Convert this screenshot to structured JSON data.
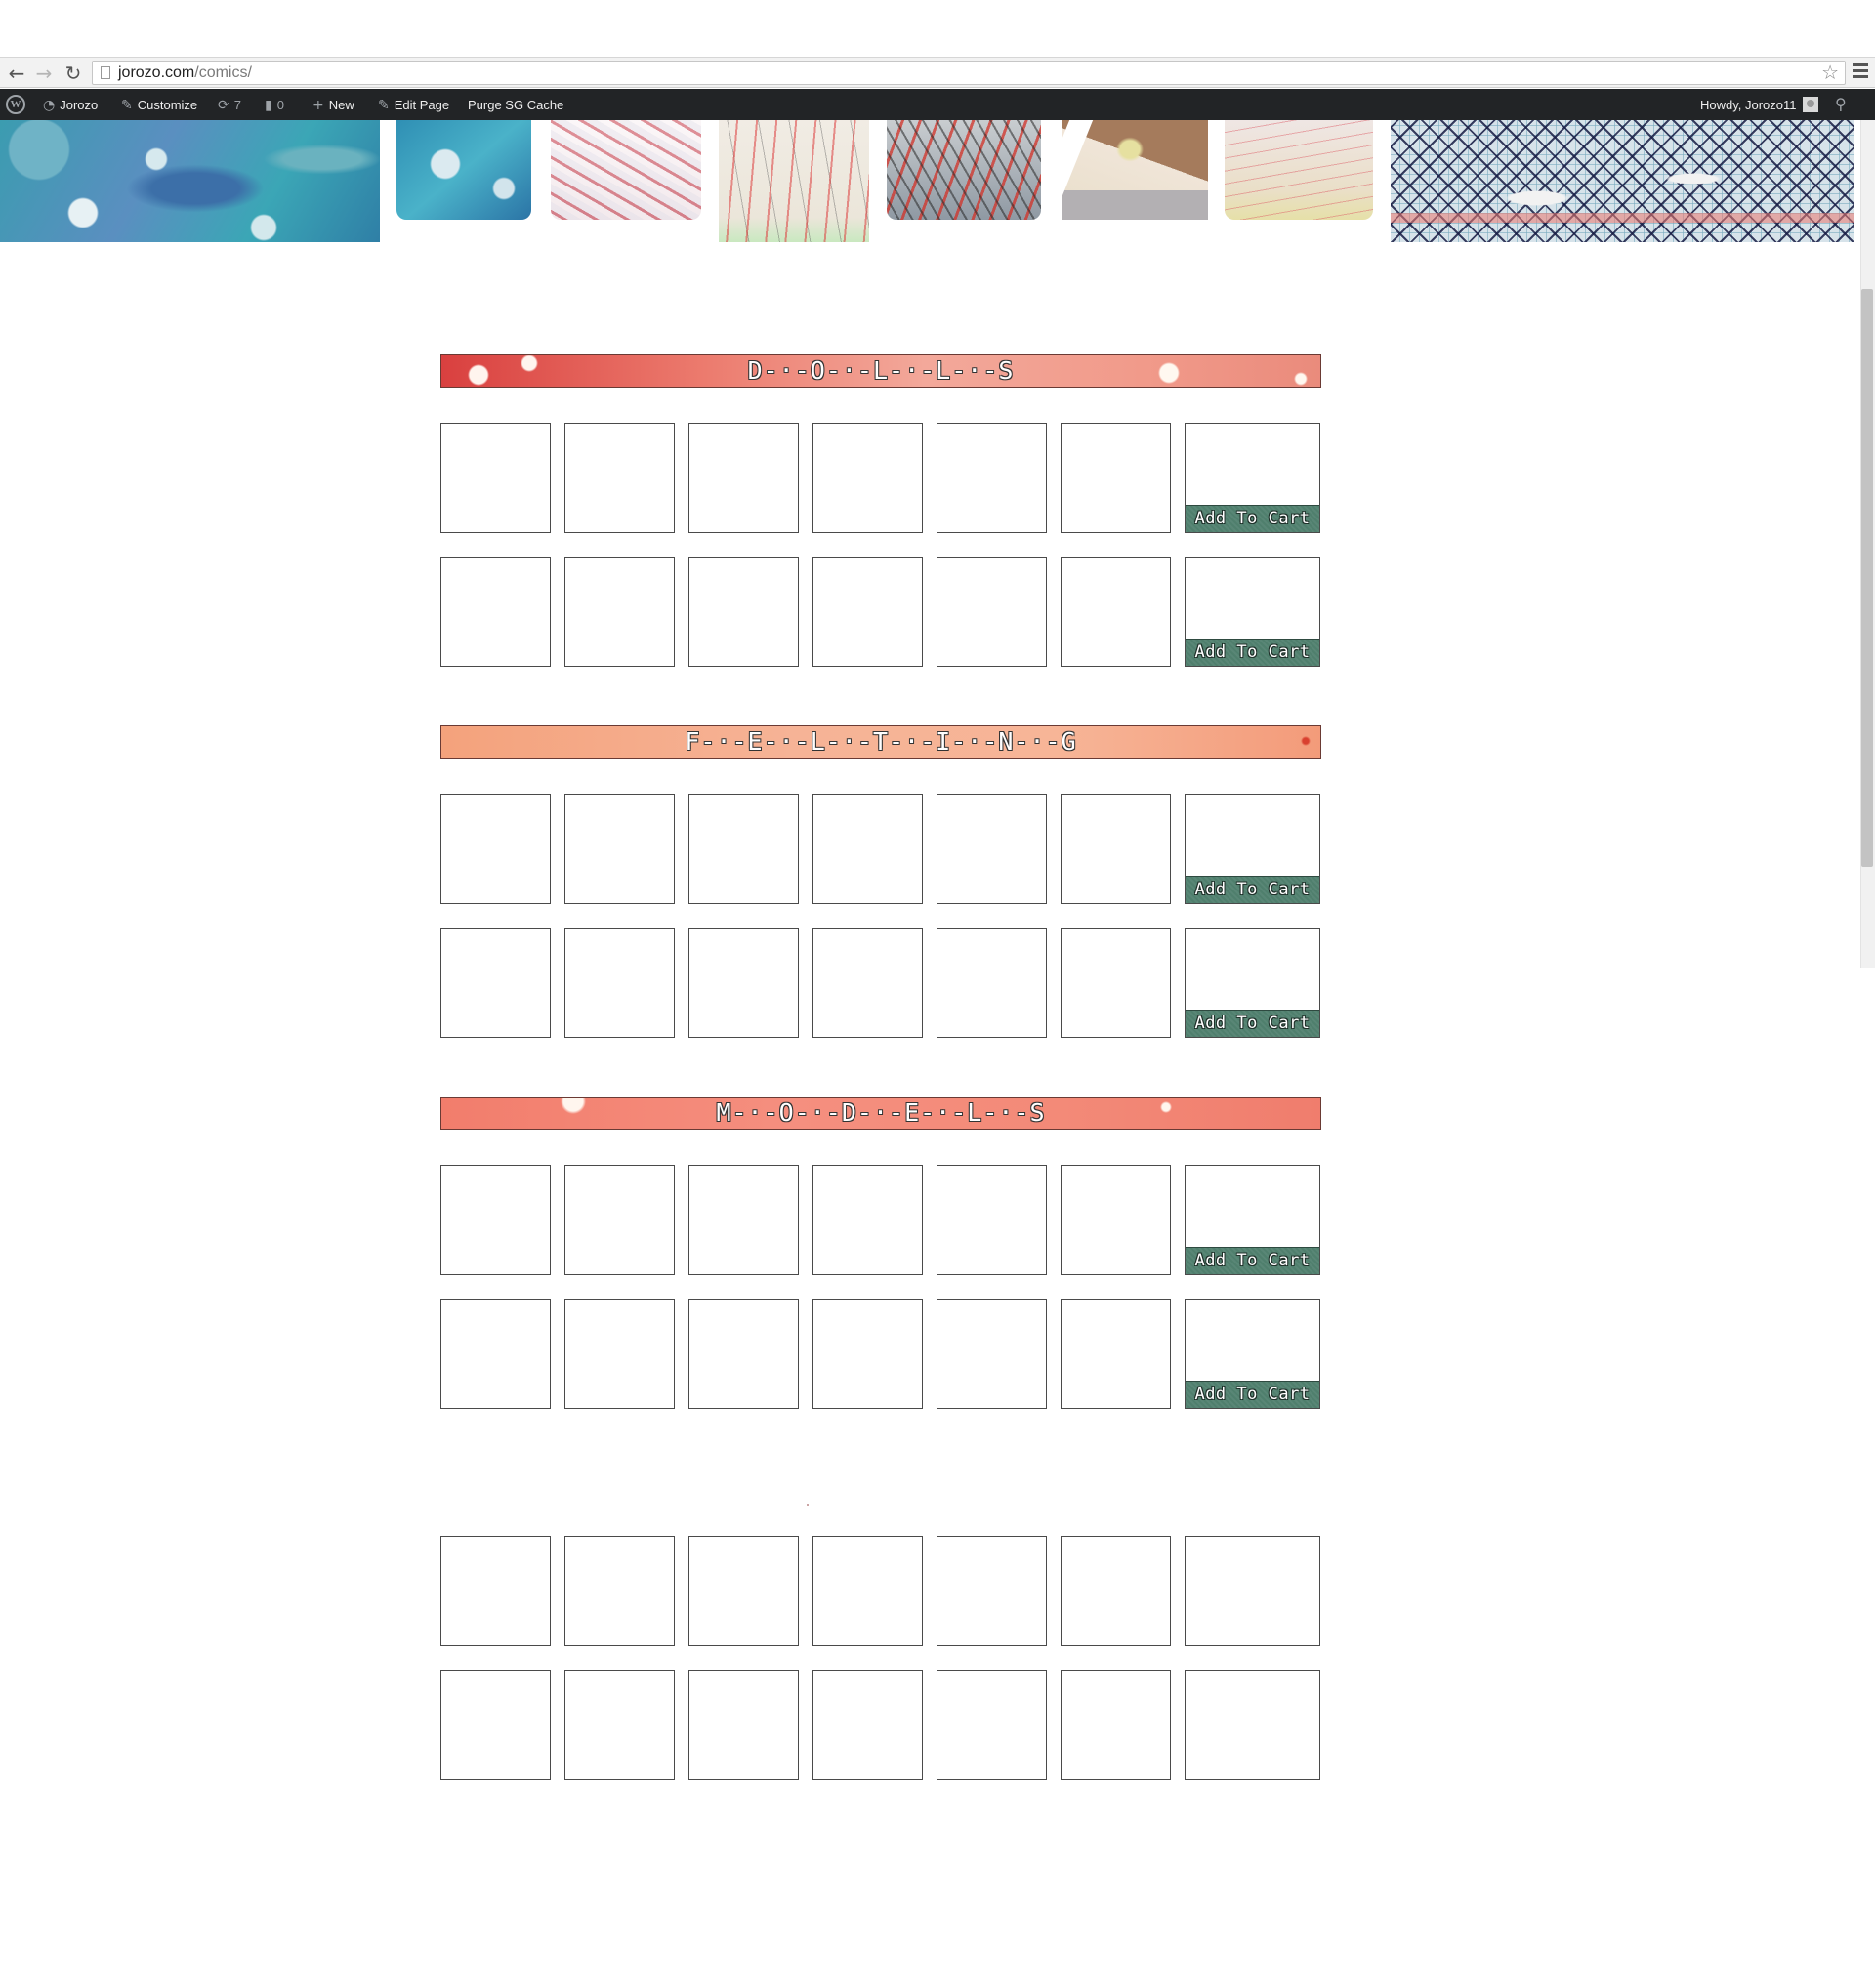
{
  "browser": {
    "url_host": "jorozo.com",
    "url_path": "/comics/"
  },
  "admin_bar": {
    "site_name": "Jorozo",
    "customize": "Customize",
    "updates_count": "7",
    "comments_count": "0",
    "new": "New",
    "edit_page": "Edit Page",
    "purge_cache": "Purge SG Cache",
    "howdy": "Howdy, Jorozo11"
  },
  "sections": [
    {
      "title": "D-·-O-·-L-·-L-·-S",
      "cart_label": "Add To Cart"
    },
    {
      "title": "F-·-E-·-L-·-T-·-I-·-N-·-G",
      "cart_label": "Add To Cart"
    },
    {
      "title": "M-·-O-·-D-·-E-·-L-·-S",
      "cart_label": "Add To Cart"
    }
  ],
  "colors": {
    "admin_bar_bg": "#222426",
    "cart_button_bg": "#4f7f6d"
  }
}
